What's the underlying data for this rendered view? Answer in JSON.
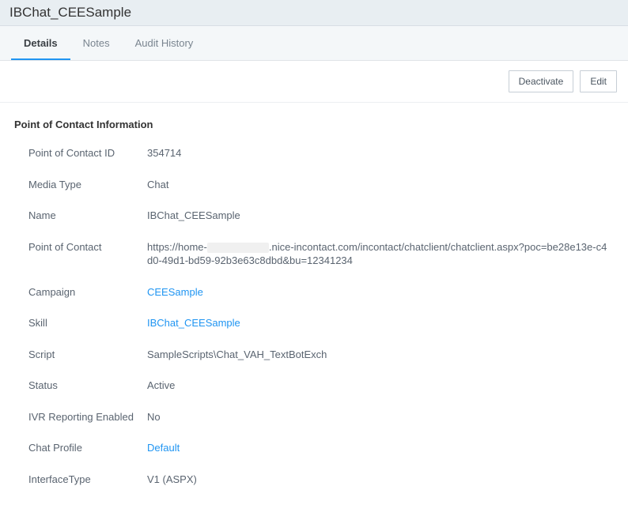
{
  "header": {
    "title": "IBChat_CEESample"
  },
  "tabs": [
    {
      "label": "Details",
      "active": true
    },
    {
      "label": "Notes",
      "active": false
    },
    {
      "label": "Audit History",
      "active": false
    }
  ],
  "actions": {
    "deactivate": "Deactivate",
    "edit": "Edit"
  },
  "section": {
    "title": "Point of Contact Information"
  },
  "fields": {
    "poc_id": {
      "label": "Point of Contact ID",
      "value": "354714"
    },
    "media_type": {
      "label": "Media Type",
      "value": "Chat"
    },
    "name": {
      "label": "Name",
      "value": "IBChat_CEESample"
    },
    "poc": {
      "label": "Point of Contact",
      "prefix": "https://home-",
      "suffix": ".nice-incontact.com/incontact/chatclient/chatclient.aspx?poc=be28e13e-c4d0-49d1-bd59-92b3e63c8dbd&bu=12341234"
    },
    "campaign": {
      "label": "Campaign",
      "value": "CEESample"
    },
    "skill": {
      "label": "Skill",
      "value": "IBChat_CEESample"
    },
    "script": {
      "label": "Script",
      "value": "SampleScripts\\Chat_VAH_TextBotExch"
    },
    "status": {
      "label": "Status",
      "value": "Active"
    },
    "ivr": {
      "label": "IVR Reporting Enabled",
      "value": "No"
    },
    "chat_profile": {
      "label": "Chat Profile",
      "value": "Default"
    },
    "interface_type": {
      "label": "InterfaceType",
      "value": "V1 (ASPX)"
    }
  }
}
